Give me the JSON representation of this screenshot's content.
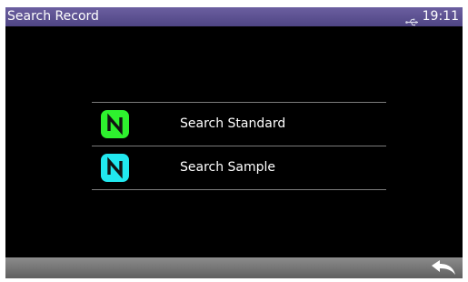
{
  "window": {
    "title": "Search Record"
  },
  "status": {
    "time": "19:11",
    "usb_icon": "usb-icon"
  },
  "menu": {
    "items": [
      {
        "label": "Search Standard",
        "icon": "standard-n-icon",
        "icon_color": "#2ef12e"
      },
      {
        "label": "Search Sample",
        "icon": "sample-n-icon",
        "icon_color": "#21e8ef"
      }
    ]
  },
  "bottom_bar": {
    "back_icon": "back-arrow-icon"
  },
  "colors": {
    "title_bar": "#5a4f92",
    "background": "#000000",
    "bottom_bar": "#777777",
    "divider": "#7c7c7c"
  }
}
